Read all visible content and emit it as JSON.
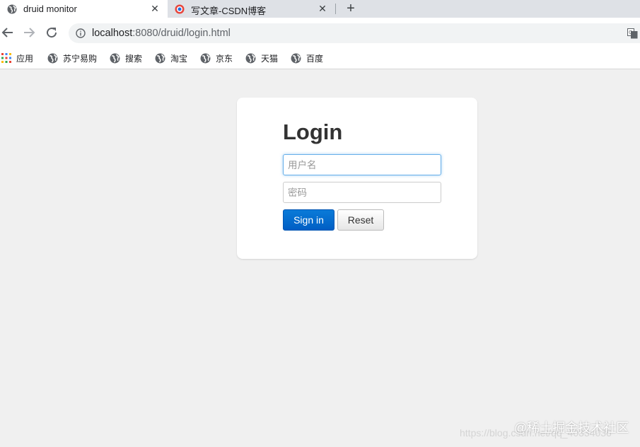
{
  "tabs": [
    {
      "title": "druid monitor",
      "icon": "globe-icon",
      "active": true
    },
    {
      "title": "写文章-CSDN博客",
      "icon": "csdn-icon",
      "active": false
    }
  ],
  "toolbar": {
    "url_host": "localhost",
    "url_rest": ":8080/druid/login.html"
  },
  "bookmarks": [
    {
      "label": "应用",
      "icon": "apps-grid-icon"
    },
    {
      "label": "苏宁易购",
      "icon": "globe-icon"
    },
    {
      "label": "搜索",
      "icon": "globe-icon"
    },
    {
      "label": "淘宝",
      "icon": "globe-icon"
    },
    {
      "label": "京东",
      "icon": "globe-icon"
    },
    {
      "label": "天猫",
      "icon": "globe-icon"
    },
    {
      "label": "百度",
      "icon": "globe-icon"
    }
  ],
  "login": {
    "heading": "Login",
    "username_placeholder": "用户名",
    "password_placeholder": "密码",
    "signin_label": "Sign in",
    "reset_label": "Reset"
  },
  "watermark": {
    "text": "@稀土掘金技术社区",
    "faint_url": "https://blog.csdn.net/qq_40334036"
  },
  "colors": {
    "primary_button": "#005ec4",
    "page_background": "#f0f0f0",
    "focus_border": "#66afe9"
  }
}
